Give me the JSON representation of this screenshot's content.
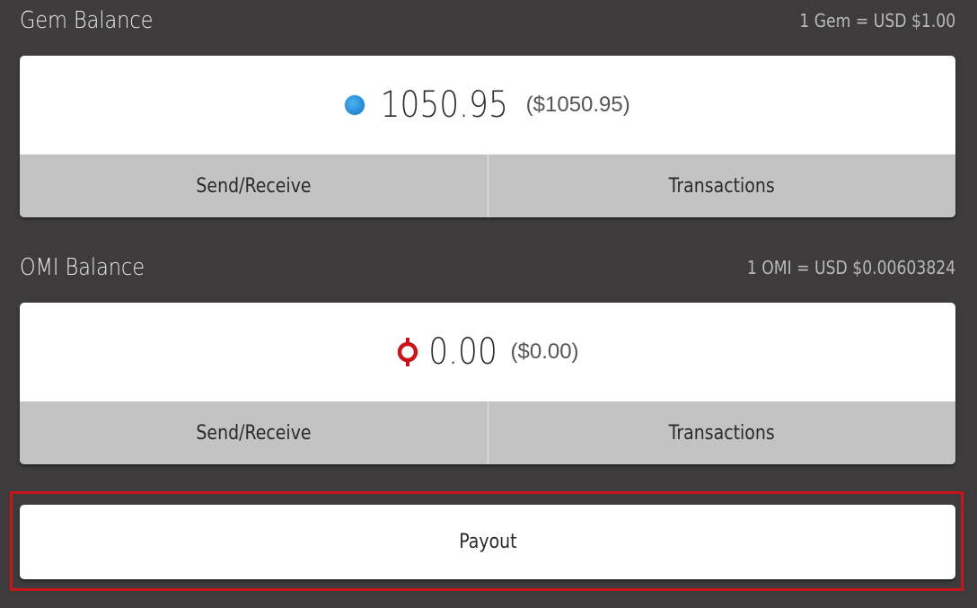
{
  "gem": {
    "title": "Gem Balance",
    "rate": "1 Gem = USD $1.00",
    "amount": "1050.95",
    "usd": "($1050.95)",
    "icon": "gem-icon",
    "icon_color": "#2a8fd8",
    "send_receive_label": "Send/Receive",
    "transactions_label": "Transactions"
  },
  "omi": {
    "title": "OMI Balance",
    "rate": "1 OMI = USD $0.00603824",
    "amount": "0.00",
    "usd": "($0.00)",
    "icon": "omi-icon",
    "icon_color": "#c8141b",
    "send_receive_label": "Send/Receive",
    "transactions_label": "Transactions"
  },
  "payout": {
    "label": "Payout",
    "highlight_color": "#c8141b"
  },
  "colors": {
    "background": "#3d3b3c",
    "card": "#ffffff",
    "action_bar": "#c3c3c3"
  }
}
